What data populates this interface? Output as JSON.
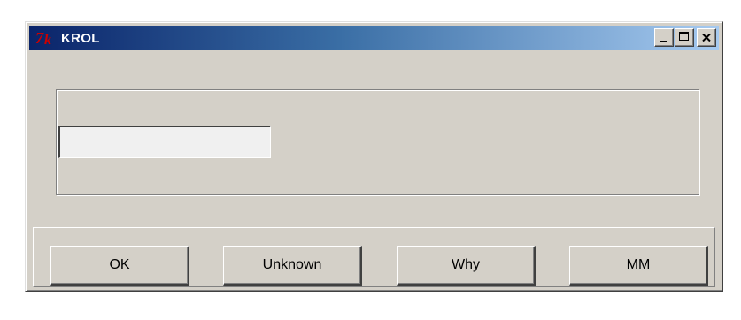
{
  "window": {
    "title": "KROL",
    "icon": "tk-feather-icon"
  },
  "entry": {
    "value": ""
  },
  "buttons": [
    {
      "accel": "O",
      "rest": "K",
      "label": "OK"
    },
    {
      "accel": "U",
      "rest": "nknown",
      "label": "Unknown"
    },
    {
      "accel": "W",
      "rest": "hy",
      "label": "Why"
    },
    {
      "accel": "M",
      "rest": "M",
      "label": "MM"
    }
  ],
  "colors": {
    "title_gradient_start": "#0a246a",
    "title_gradient_end": "#a6caf0",
    "face": "#d4d0c8",
    "entry_bg": "#f0f0f0",
    "tk_icon_red": "#cc0000"
  }
}
